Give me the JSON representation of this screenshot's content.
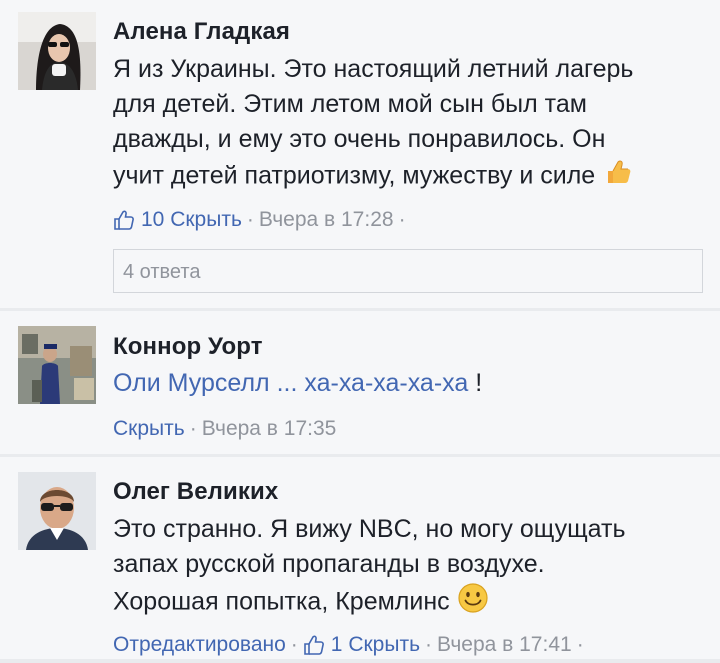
{
  "comments": [
    {
      "author": "Алена Гладкая",
      "text_lines": [
        "Я из Украины. Это настоящий летний лагерь",
        "для детей. Этим летом мой сын был там",
        "дважды, и ему это очень понравилось. Он",
        "учит детей патриотизму, мужеству и силе"
      ],
      "emoji": "thumbs-up-icon",
      "like_count": "10",
      "hide_label": "Скрыть",
      "time": "Вчера в 17:28",
      "replies_label": "4 ответа"
    },
    {
      "author": "Коннор Уорт",
      "mention": "Оли Мурселл ... ха-ха-ха-ха-ха",
      "text_suffix": " !",
      "hide_label": "Скрыть",
      "time": "Вчера в 17:35"
    },
    {
      "author": "Олег Великих",
      "text_lines": [
        "Это странно. Я вижу NBC, но могу ощущать",
        "запах русской пропаганды в воздухе.",
        "Хорошая попытка, Кремлинс"
      ],
      "emoji": "smiley-icon",
      "edited_label": "Отредактировано",
      "like_count": "1",
      "hide_label": "Скрыть",
      "time": "Вчера в 17:41"
    }
  ],
  "colors": {
    "link": "#4267b2",
    "text": "#1d2129",
    "meta": "#90949c",
    "background": "#f6f7f9",
    "separator": "#e9ebee"
  }
}
